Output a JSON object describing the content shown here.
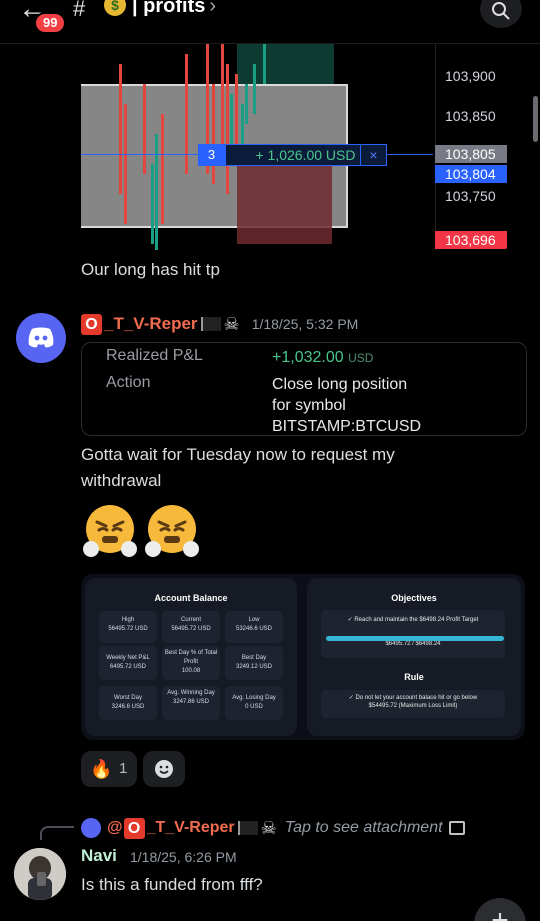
{
  "header": {
    "badge_count": "99",
    "hash": "#",
    "channel_emoji": "🤑",
    "channel_name": "| profits",
    "chevron": "›"
  },
  "chart": {
    "price_labels": [
      {
        "text": "103,900"
      },
      {
        "text": "103,850"
      },
      {
        "text": "103,750"
      }
    ],
    "price_tags": [
      {
        "text": "103,805",
        "color": "#787b86"
      },
      {
        "text": "103,804",
        "color": "#2962ff"
      },
      {
        "text": "103,696",
        "color": "#f23645"
      }
    ],
    "position": {
      "qty": "3",
      "pnl": "+ 1,026.00 USD",
      "close": "×"
    }
  },
  "messages": {
    "m1_text": "Our long has hit tp",
    "author": {
      "name": "_T_V-Reper",
      "o_badge": "O",
      "skull": "☠",
      "timestamp": "1/18/25, 5:32 PM"
    },
    "pnl_card": {
      "realized_label": "Realized P&L",
      "realized_value": "+1,032.00",
      "realized_unit": "USD",
      "action_label": "Action",
      "action_line1": "Close long position",
      "action_line2": "for symbol",
      "action_line3": "BITSTAMP:BTCUSD"
    },
    "m2_line1": "Gotta wait for   Tuesday now to request my",
    "m2_line2": "withdrawal"
  },
  "attachment": {
    "balance_title": "Account Balance",
    "stats": [
      {
        "k": "High",
        "v": "56495.72 USD"
      },
      {
        "k": "Current",
        "v": "56495.72 USD"
      },
      {
        "k": "Low",
        "v": "53246.6 USD"
      },
      {
        "k": "Weekly Net P&L",
        "v": "6495.72 USD"
      },
      {
        "k": "Best Day % of Total Profit",
        "v": "100.08"
      },
      {
        "k": "Best Day",
        "v": "3249.12 USD"
      },
      {
        "k": "Worst Day",
        "v": "3246.6 USD"
      },
      {
        "k": "Avg. Winning Day",
        "v": "3247.86 USD"
      },
      {
        "k": "Avg. Losing Day",
        "v": "0 USD"
      }
    ],
    "objectives_title": "Objectives",
    "objective_text": "✓ Reach and maintain the $6498.24 Profit Target",
    "objective_progress": "$6495.72 / $6498.24",
    "rule_title": "Rule",
    "rule_text": "✓ Do not let your account balace hit or go below",
    "rule_value": "$54495.72 (Maximum Loss Limit)"
  },
  "reactions": {
    "fire_count": "1"
  },
  "reply": {
    "at_name": "@",
    "author": "_T_V-Reper",
    "o_badge": "O",
    "skull": "☠",
    "hint": "Tap to see attachment"
  },
  "navi": {
    "name": "Navi",
    "timestamp": "1/18/25, 6:26 PM",
    "text": "Is this a funded from fff?"
  },
  "fab": {
    "label": "+"
  }
}
